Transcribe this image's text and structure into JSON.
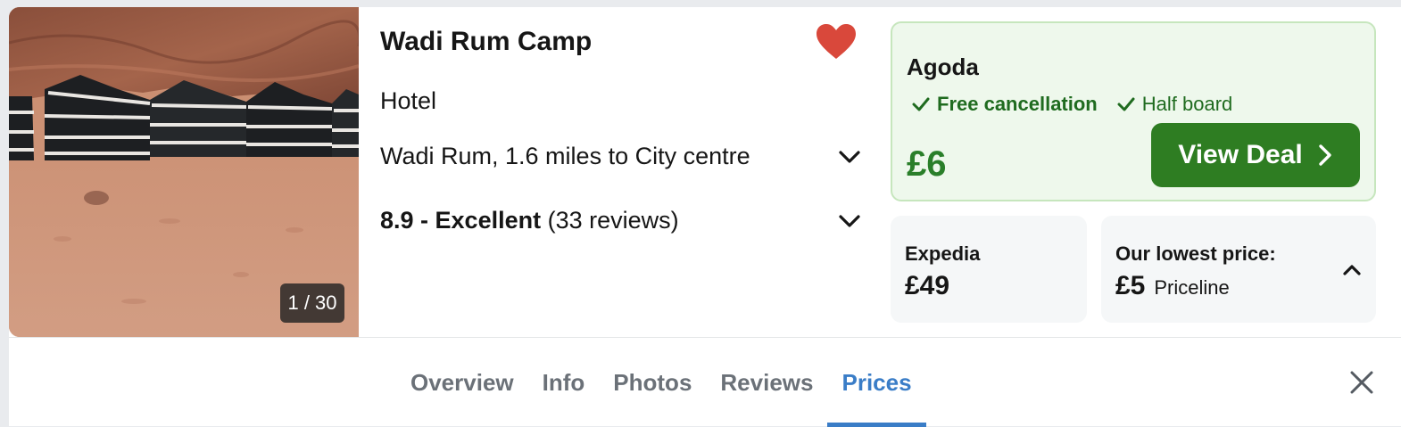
{
  "hotel": {
    "name": "Wadi Rum Camp",
    "type": "Hotel",
    "location": "Wadi Rum, 1.6 miles to City centre",
    "rating_score": "8.9 - Excellent",
    "rating_reviews": "(33 reviews)",
    "favourited": true
  },
  "gallery": {
    "counter": "1 / 30"
  },
  "featured_deal": {
    "provider": "Agoda",
    "features": [
      "Free cancellation",
      "Half board"
    ],
    "price": "£6",
    "button_label": "View Deal"
  },
  "other_deals": {
    "expedia": {
      "provider": "Expedia",
      "price": "£49"
    },
    "lowest": {
      "label": "Our lowest price:",
      "price": "£5",
      "provider": "Priceline"
    }
  },
  "tabs": {
    "items": [
      {
        "label": "Overview"
      },
      {
        "label": "Info"
      },
      {
        "label": "Photos"
      },
      {
        "label": "Reviews"
      },
      {
        "label": "Prices"
      }
    ],
    "active": "Prices"
  },
  "icons": {
    "favourite": "heart-icon",
    "expand": "chevron-down-icon",
    "collapse": "chevron-up-icon",
    "check": "check-icon",
    "arrow": "chevron-right-icon",
    "close": "close-icon"
  },
  "colors": {
    "heart": "#d9483b",
    "deal_green": "#2e7d22",
    "deal_bg": "#eef8ec",
    "tab_active": "#3a7dc7"
  }
}
